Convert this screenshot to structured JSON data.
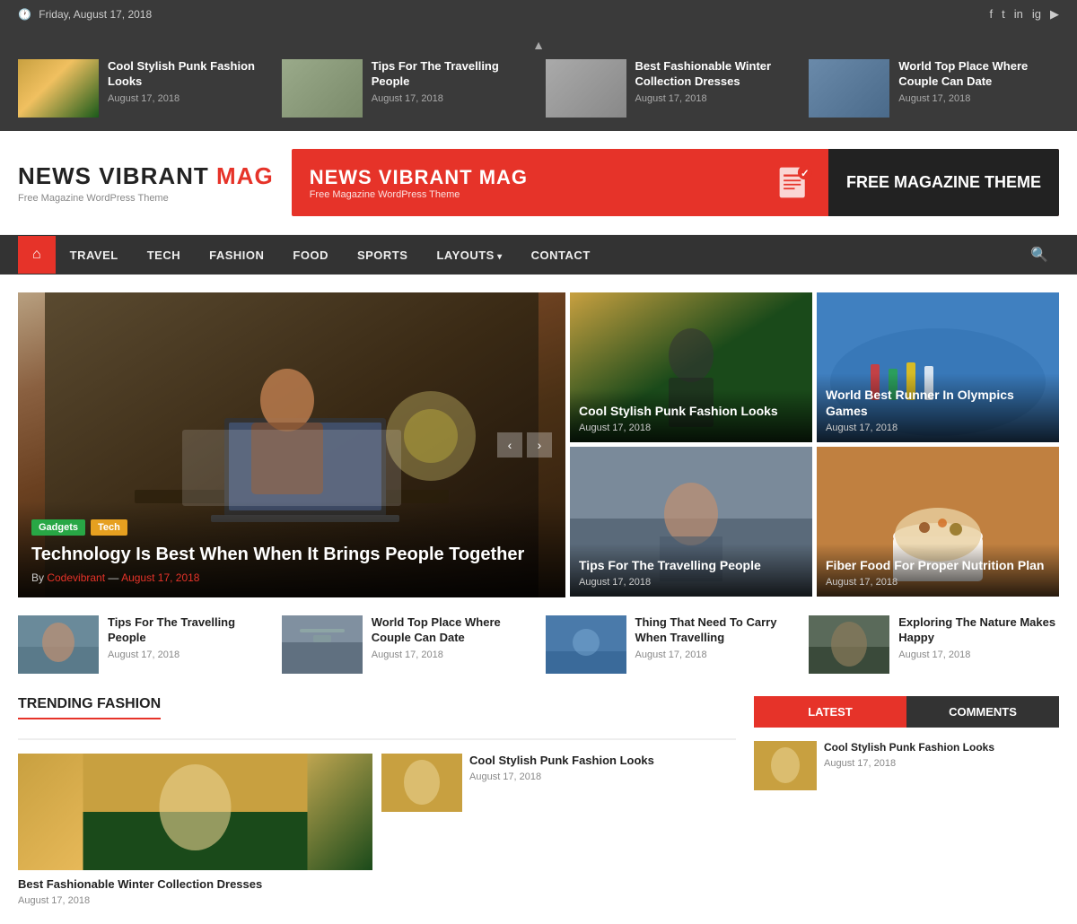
{
  "site": {
    "logo_black": "NEWS VIBRANT",
    "logo_red": "MAG",
    "logo_sub": "Free Magazine WordPress Theme",
    "banner_title": "NEWS VIBRANT MAG",
    "banner_sub": "Free Magazine WordPress Theme",
    "banner_right": "FREE MAGAZINE THEME"
  },
  "topbar": {
    "date": "Friday, August 17, 2018"
  },
  "nav": {
    "home_icon": "⌂",
    "items": [
      {
        "label": "TRAVEL",
        "has_arrow": false
      },
      {
        "label": "TECH",
        "has_arrow": false
      },
      {
        "label": "FASHION",
        "has_arrow": false
      },
      {
        "label": "FOOD",
        "has_arrow": false
      },
      {
        "label": "SPORTS",
        "has_arrow": false
      },
      {
        "label": "LAYOUTS",
        "has_arrow": true
      },
      {
        "label": "CONTACT",
        "has_arrow": false
      }
    ]
  },
  "ticker": {
    "items": [
      {
        "title": "Cool Stylish Punk Fashion Looks",
        "date": "August 17, 2018",
        "color": "#c8a040"
      },
      {
        "title": "Tips For The Travelling People",
        "date": "August 17, 2018",
        "color": "#8a9a7a"
      },
      {
        "title": "Best Fashionable Winter Collection Dresses",
        "date": "August 17, 2018",
        "color": "#aaaaaa"
      },
      {
        "title": "World Top Place Where Couple Can Date",
        "date": "August 17, 2018",
        "color": "#6a8aaa"
      }
    ]
  },
  "featured": {
    "main": {
      "tags": [
        "Gadgets",
        "Tech"
      ],
      "title": "Technology Is Best When When It Brings People Together",
      "author": "Codevibrant",
      "date": "August 17, 2018"
    },
    "side": [
      {
        "title": "Cool Stylish Punk Fashion Looks",
        "date": "August 17, 2018",
        "type": "fashion"
      },
      {
        "title": "Tips For The Travelling People",
        "date": "August 17, 2018",
        "type": "travel"
      },
      {
        "title": "World Best Runner In Olympics Games",
        "date": "August 17, 2018",
        "type": "runner"
      },
      {
        "title": "Fiber Food For Proper Nutrition Plan",
        "date": "August 17, 2018",
        "type": "food"
      }
    ]
  },
  "small_cards": [
    {
      "title": "Tips For The Travelling People",
      "date": "August 17, 2018",
      "type": "travel"
    },
    {
      "title": "World Top Place Where Couple Can Date",
      "date": "August 17, 2018",
      "type": "couple"
    },
    {
      "title": "Thing That Need To Carry When Travelling",
      "date": "August 17, 2018",
      "type": "thing"
    },
    {
      "title": "Exploring The Nature Makes Happy",
      "date": "August 17, 2018",
      "type": "nature"
    }
  ],
  "trending": {
    "section_title": "TRENDING FASHION",
    "items": [
      {
        "title": "Best Fashionable Winter Collection Dresses",
        "date": "August 17, 2018",
        "type": "large",
        "color": "#c8a040"
      },
      {
        "title": "Cool Stylish Punk Fashion Looks",
        "date": "August 17, 2018",
        "type": "small",
        "color": "#8a6a4a"
      }
    ]
  },
  "sidebar": {
    "tab_latest": "LATEST",
    "tab_comments": "COMMENTS",
    "latest_items": [
      {
        "title": "Cool Stylish Punk Fashion Looks",
        "date": "August 17, 2018",
        "color": "#c8a040"
      }
    ]
  },
  "social": {
    "icons": [
      "f",
      "t",
      "in",
      "ig",
      "yt"
    ]
  }
}
